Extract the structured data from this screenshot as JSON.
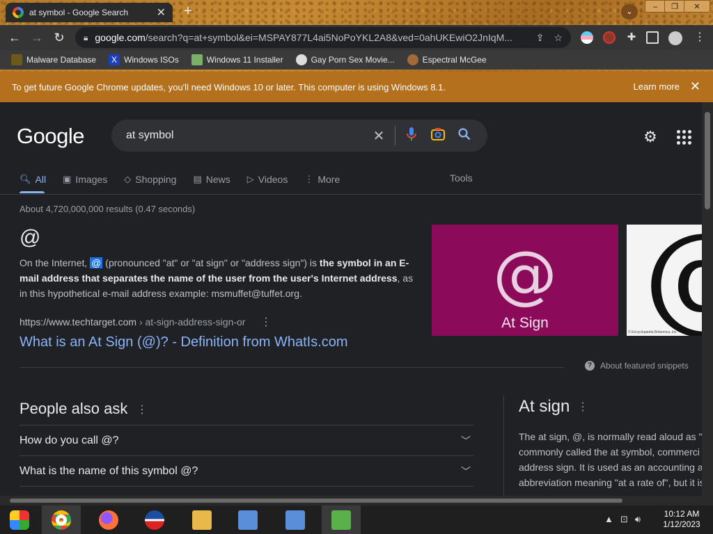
{
  "browser": {
    "tab_title": "at symbol - Google Search",
    "tab_close": "✕",
    "new_tab": "+",
    "url_host": "google.com",
    "url_path": "/search?q=at+symbol&ei=MSPAY877L4ai5NoPoYKL2A8&ved=0ahUKEwiO2JnIqM...",
    "bookmarks": [
      "Malware Database",
      "Windows ISOs",
      "Windows 11 Installer",
      "Gay Porn Sex Movie...",
      "Espectral McGee"
    ]
  },
  "banner": {
    "message": "To get future Google Chrome updates, you'll need Windows 10 or later. This computer is using Windows 8.1.",
    "learn_more": "Learn more"
  },
  "search": {
    "logo": "Google",
    "query": "at symbol",
    "tabs": [
      "All",
      "Images",
      "Shopping",
      "News",
      "Videos",
      "More"
    ],
    "tools": "Tools",
    "stats": "About 4,720,000,000 results (0.47 seconds)"
  },
  "featured": {
    "title": "@",
    "text_1": "On the Internet, ",
    "highlight": "@",
    "text_2": " (pronounced \"at\" or \"at sign\" or \"address sign\") is ",
    "bold": "the symbol in an E-mail address that separates the name of the user from the user's Internet address",
    "text_3": ", as in this hypothetical e-mail address example: msmuffet@tuffet.org.",
    "cite_host": "https://www.techtarget.com",
    "cite_path": " › at-sign-address-sign-or",
    "link": "What is an At Sign (@)? - Definition from WhatIs.com",
    "image_caption": "At Sign",
    "image_symbol": "@",
    "image2_credit": "© Encyclopædia Britannica, Inc.",
    "about": "About featured snippets"
  },
  "paa": {
    "title": "People also ask",
    "questions": [
      "How do you call @?",
      "What is the name of this symbol @?"
    ]
  },
  "knowledge_panel": {
    "title": "At sign",
    "lines": [
      "The at sign, @, is normally read aloud as \"a",
      "commonly called the at symbol, commerci",
      "address sign. It is used as an accounting a",
      "abbreviation meaning \"at a rate of\", but it is"
    ]
  },
  "taskbar": {
    "time": "10:12 AM",
    "date": "1/12/2023"
  },
  "colors": {
    "page_bg": "#202124",
    "link": "#8ab4f8",
    "banner": "#b5701e",
    "image_tile": "#8c0a5a"
  }
}
